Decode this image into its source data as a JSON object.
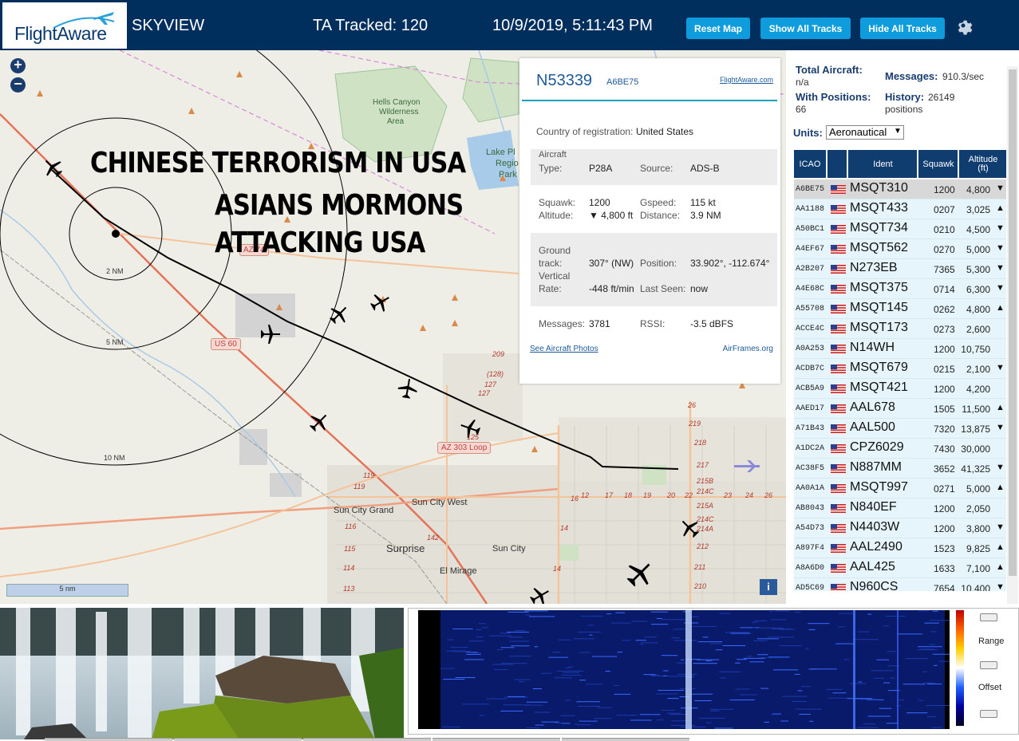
{
  "header": {
    "logo_text": "FlightAware",
    "app_title": "SKYVIEW",
    "tracked_text": "TA Tracked: 120",
    "datetime": "10/9/2019, 5:11:43 PM",
    "buttons": {
      "reset": "Reset Map",
      "show_all": "Show All Tracks",
      "hide_all": "Hide All Tracks"
    },
    "settings_icon": "gear-icon"
  },
  "map": {
    "overlay_lines": [
      "CHINESE TERRORISM IN USA",
      "ASIANS MORMONS",
      "ATTACKING USA"
    ],
    "range_rings": [
      "2 NM",
      "5 NM",
      "10 NM"
    ],
    "scale_label": "5 nm",
    "zoom_in": "+",
    "zoom_out": "−",
    "info_label": "i",
    "places": {
      "wilderness": [
        "Hells Canyon",
        "Wilderness",
        "Area"
      ],
      "lake": [
        "Lake Pl",
        "Regio",
        "Park"
      ],
      "sun_city_grand": "Sun City Grand",
      "sun_city_west": "Sun City West",
      "surprise": "Surprise",
      "sun_city": "Sun City",
      "el_mirage": "El Mirage"
    },
    "shields": {
      "us60": "US 60",
      "az303": "AZ 303 Loop",
      "az74": "AZ 74"
    },
    "exit_numbers": [
      "(128)",
      "127",
      "127",
      "125",
      "119",
      "119",
      "116",
      "115",
      "114",
      "113",
      "142",
      "14",
      "14",
      "12",
      "16",
      "17",
      "18",
      "19",
      "20",
      "22",
      "23",
      "24",
      "26",
      "26",
      "219",
      "218",
      "217",
      "215B",
      "214C",
      "215A",
      "214C",
      "214A",
      "212",
      "211",
      "210",
      "209",
      "(1"
    ]
  },
  "popup": {
    "callsign": "N53339",
    "hex": "A6BE75",
    "fa_link": "FlightAware.com",
    "country_label": "Country of registration:",
    "country_value": "United States",
    "aircraft_label": "Aircraft",
    "type_label": "Type:",
    "type_value": "P28A",
    "source_label": "Source:",
    "source_value": "ADS-B",
    "squawk_label": "Squawk:",
    "squawk_value": "1200",
    "gspeed_label": "Gspeed:",
    "gspeed_value": "115 kt",
    "altitude_label": "Altitude:",
    "altitude_value": "▼ 4,800 ft",
    "distance_label": "Distance:",
    "distance_value": "3.9 NM",
    "ground_label": "Ground",
    "track_label": "track:",
    "track_value": "307° (NW)",
    "position_label": "Position:",
    "position_value": "33.902°, -112.674°",
    "vertical_label": "Vertical",
    "rate_label": "Rate:",
    "rate_value": "-448 ft/min",
    "lastseen_label": "Last Seen:",
    "lastseen_value": "now",
    "messages_label": "Messages:",
    "messages_value": "3781",
    "rssi_label": "RSSI:",
    "rssi_value": "-3.5 dBFS",
    "photos_link": "See Aircraft Photos",
    "airframes_link": "AirFrames.org"
  },
  "sidebar": {
    "total_label": "Total Aircraft:",
    "total_value": "n/a",
    "messages_label": "Messages:",
    "messages_value": "910.3/sec",
    "positions_label": "With Positions:",
    "positions_value": "66",
    "history_label": "History:",
    "history_value": "26149",
    "history_unit": "positions",
    "units_label": "Units:",
    "units_value": "Aeronautical",
    "columns": {
      "icao": "ICAO",
      "ident": "Ident",
      "squawk": "Squawk",
      "altitude": "Altitude",
      "altitude_unit": "(ft)"
    },
    "rows": [
      {
        "icao": "A6BE75",
        "ident": "MSQT310",
        "squawk": "1200",
        "altitude": "4,800",
        "trend": "▼"
      },
      {
        "icao": "AA1188",
        "ident": "MSQT433",
        "squawk": "0207",
        "altitude": "3,025",
        "trend": "▲"
      },
      {
        "icao": "A50BC1",
        "ident": "MSQT734",
        "squawk": "0210",
        "altitude": "4,500",
        "trend": "▼"
      },
      {
        "icao": "A4EF67",
        "ident": "MSQT562",
        "squawk": "0270",
        "altitude": "5,000",
        "trend": "▼"
      },
      {
        "icao": "A2B207",
        "ident": "N273EB",
        "squawk": "7365",
        "altitude": "5,300",
        "trend": "▼"
      },
      {
        "icao": "A4E68C",
        "ident": "MSQT375",
        "squawk": "0714",
        "altitude": "6,300",
        "trend": "▼"
      },
      {
        "icao": "A55708",
        "ident": "MSQT145",
        "squawk": "0262",
        "altitude": "4,800",
        "trend": "▲"
      },
      {
        "icao": "ACCE4C",
        "ident": "MSQT173",
        "squawk": "0273",
        "altitude": "2,600",
        "trend": ""
      },
      {
        "icao": "A0A253",
        "ident": "N14WH",
        "squawk": "1200",
        "altitude": "10,750",
        "trend": ""
      },
      {
        "icao": "ACDB7C",
        "ident": "MSQT679",
        "squawk": "0215",
        "altitude": "2,100",
        "trend": "▼"
      },
      {
        "icao": "ACB5A9",
        "ident": "MSQT421",
        "squawk": "1200",
        "altitude": "4,200",
        "trend": ""
      },
      {
        "icao": "AAED17",
        "ident": "AAL678",
        "squawk": "1505",
        "altitude": "11,500",
        "trend": "▲"
      },
      {
        "icao": "A71B43",
        "ident": "AAL500",
        "squawk": "7320",
        "altitude": "13,875",
        "trend": "▼"
      },
      {
        "icao": "A1DC2A",
        "ident": "CPZ6029",
        "squawk": "7430",
        "altitude": "30,000",
        "trend": ""
      },
      {
        "icao": "AC38F5",
        "ident": "N887MM",
        "squawk": "3652",
        "altitude": "41,325",
        "trend": "▼"
      },
      {
        "icao": "AA0A1A",
        "ident": "MSQT997",
        "squawk": "0271",
        "altitude": "5,000",
        "trend": "▲"
      },
      {
        "icao": "AB8043",
        "ident": "N840EF",
        "squawk": "1200",
        "altitude": "2,050",
        "trend": ""
      },
      {
        "icao": "A54D73",
        "ident": "N4403W",
        "squawk": "1200",
        "altitude": "3,800",
        "trend": "▼"
      },
      {
        "icao": "A897F4",
        "ident": "AAL2490",
        "squawk": "1523",
        "altitude": "9,825",
        "trend": "▲"
      },
      {
        "icao": "A8A6D0",
        "ident": "AAL425",
        "squawk": "1633",
        "altitude": "7,100",
        "trend": "▲"
      },
      {
        "icao": "AD5C69",
        "ident": "N960CS",
        "squawk": "7654",
        "altitude": "10,400",
        "trend": "▼"
      }
    ]
  },
  "spectrum": {
    "range_label": "Range",
    "offset_label": "Offset"
  },
  "colors": {
    "header_bg": "#002f5d",
    "button_bg": "#0f9cdc",
    "table_head_bg": "#0f3d70",
    "row_bg": "#e6f5fc",
    "link": "#1e5a99"
  }
}
